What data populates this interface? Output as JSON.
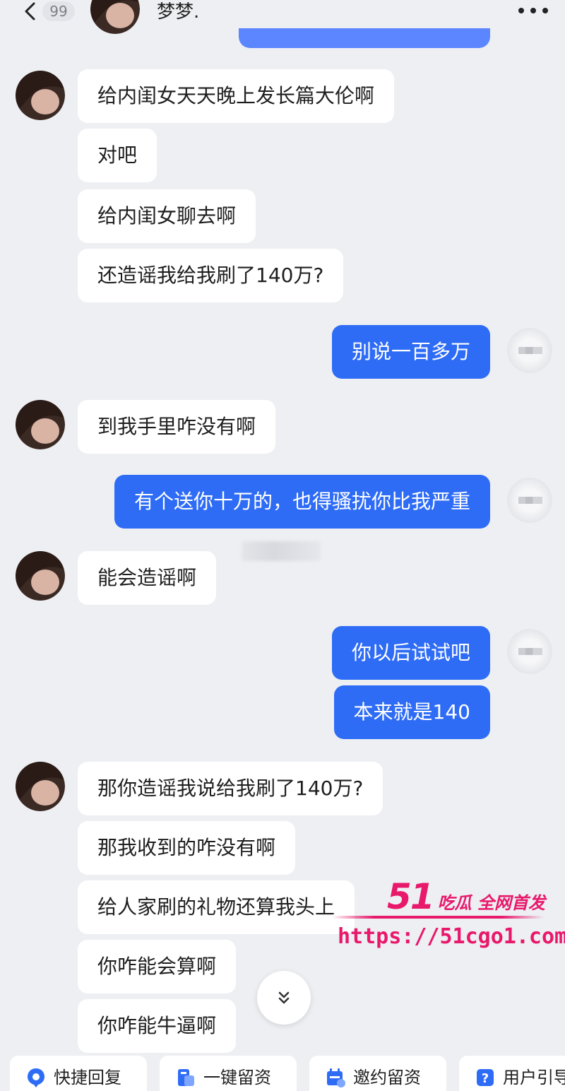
{
  "header": {
    "unread_count": "99",
    "contact_name": "梦梦."
  },
  "messages": [
    {
      "dir": "in",
      "text": "给内闺女天天晚上发长篇大伦啊"
    },
    {
      "dir": "in",
      "text": "对吧"
    },
    {
      "dir": "in",
      "text": "给内闺女聊去啊"
    },
    {
      "dir": "in",
      "text": "还造谣我给我刷了140万?"
    },
    {
      "dir": "out",
      "text": "别说一百多万"
    },
    {
      "dir": "in",
      "text": "到我手里咋没有啊"
    },
    {
      "dir": "out",
      "text": "有个送你十万的，也得骚扰你比我严重"
    },
    {
      "dir": "in",
      "text": "能会造谣啊"
    },
    {
      "dir": "out",
      "text": "你以后试试吧"
    },
    {
      "dir": "out",
      "text": "本来就是140"
    },
    {
      "dir": "in",
      "text": "那你造谣我说给我刷了140万?"
    },
    {
      "dir": "in",
      "text": "那我收到的咋没有啊"
    },
    {
      "dir": "in",
      "text": "给人家刷的礼物还算我头上"
    },
    {
      "dir": "in",
      "text": "你咋能会算啊"
    },
    {
      "dir": "in",
      "text": "你咋能牛逼啊"
    }
  ],
  "watermark": {
    "brand_number": "51",
    "brand_text": "吃瓜 全网首发",
    "url": "https://51cgo1.com"
  },
  "quick_actions": [
    {
      "label": "快捷回复",
      "icon": "quick-reply-icon"
    },
    {
      "label": "一键留资",
      "icon": "lead-form-icon"
    },
    {
      "label": "邀约留资",
      "icon": "invite-calendar-icon"
    },
    {
      "label": "用户引导",
      "icon": "help-icon"
    }
  ],
  "colors": {
    "outgoing_bubble": "#2e6cf6",
    "incoming_bubble": "#ffffff",
    "background": "#eeeff3",
    "watermark": "#e8186b"
  }
}
